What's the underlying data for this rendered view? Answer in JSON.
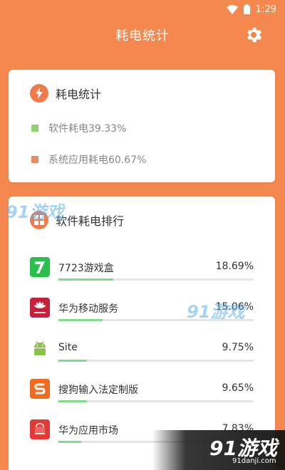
{
  "status": {
    "time": "1:29"
  },
  "header": {
    "title": "耗电统计"
  },
  "summary": {
    "title": "耗电统计",
    "items": [
      {
        "label": "软件耗电39.33%",
        "color": "#8FD36A"
      },
      {
        "label": "系统应用耗电60.67%",
        "color": "#E88A63"
      }
    ]
  },
  "ranking": {
    "title": "软件耗电排行",
    "apps": [
      {
        "name": "7723游戏盒",
        "percent": "18.69%",
        "value": 18.69,
        "icon": "7723-app-icon"
      },
      {
        "name": "华为移动服务",
        "percent": "15.06%",
        "value": 15.06,
        "icon": "huawei-icon"
      },
      {
        "name": "Site",
        "percent": "9.75%",
        "value": 9.75,
        "icon": "android-icon"
      },
      {
        "name": "搜狗输入法定制版",
        "percent": "9.65%",
        "value": 9.65,
        "icon": "sogou-icon"
      },
      {
        "name": "华为应用市场",
        "percent": "7.83%",
        "value": 7.83,
        "icon": "huawei-appgallery-icon"
      }
    ]
  },
  "watermarks": {
    "brand": "91游戏",
    "url": "91danji.com"
  },
  "colors": {
    "accent": "#F5884E",
    "bar": "#7EDC8A",
    "track": "#E6E6E6"
  }
}
